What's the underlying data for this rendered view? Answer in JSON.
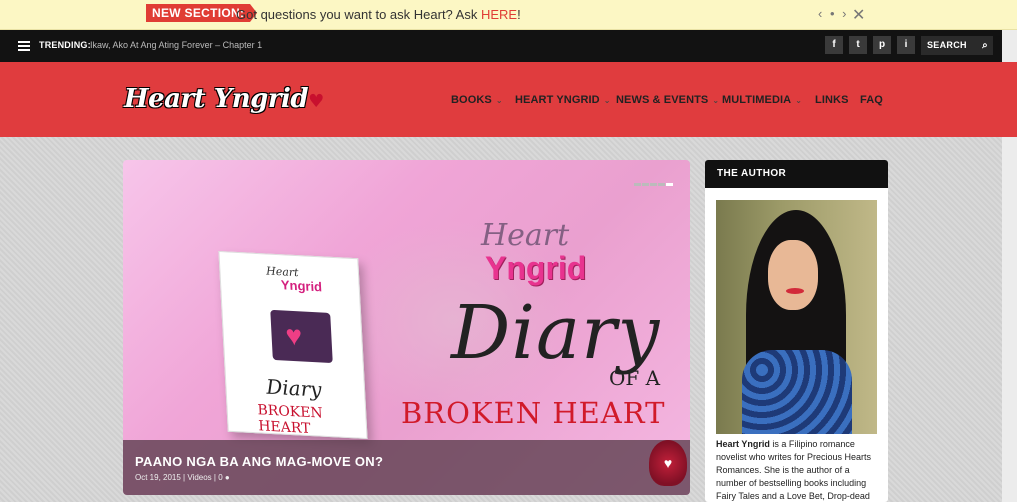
{
  "notice": {
    "badge": "NEW SECTION:",
    "text": "Got questions you want to ask Heart? Ask ",
    "link": "HERE",
    "after": "!",
    "arrows": "‹ • ›",
    "close": "✕"
  },
  "topbar": {
    "trending_label": "TRENDING:",
    "trending_text": "Ikaw, Ako At Ang Ating Forever – Chapter 1",
    "social": [
      "f",
      "t",
      "p",
      "i"
    ],
    "search_label": "SEARCH",
    "search_icon": "⌕"
  },
  "header": {
    "logo": "Heart Yngrid",
    "nav": [
      {
        "label": "BOOKS",
        "caret": "⌄"
      },
      {
        "label": "HEART YNGRID",
        "caret": "⌄"
      },
      {
        "label": "NEWS & EVENTS",
        "caret": "⌄"
      },
      {
        "label": "MULTIMEDIA",
        "caret": "⌄"
      },
      {
        "label": "LINKS",
        "caret": ""
      },
      {
        "label": "FAQ",
        "caret": ""
      }
    ]
  },
  "slider": {
    "book_heart": "Heart",
    "book_yngrid": "Yngrid",
    "book_diary": "Diary",
    "book_broken": "BROKEN HEART",
    "script_heart": "Heart",
    "yngrid": "Yngrid",
    "diary": "Diary",
    "of_a": "OF A",
    "broken_heart": "BROKEN HEART",
    "caption_title": "PAANO NGA BA ANG MAG-MOVE ON?",
    "caption_date": "Oct 19, 2015",
    "caption_category": "Videos",
    "caption_comments": "0"
  },
  "sidebar": {
    "heading": "THE AUTHOR",
    "author_name": "Heart Yngrid",
    "bio": " is a Filipino romance novelist who writes for Precious Hearts Romances. She is the author of a number of bestselling books including Fairy Tales and a Love Bet, Drop-dead"
  },
  "colors": {
    "accent_red": "#e03c3e",
    "topbar": "#121212",
    "notice_bg": "#fcf7c4"
  }
}
